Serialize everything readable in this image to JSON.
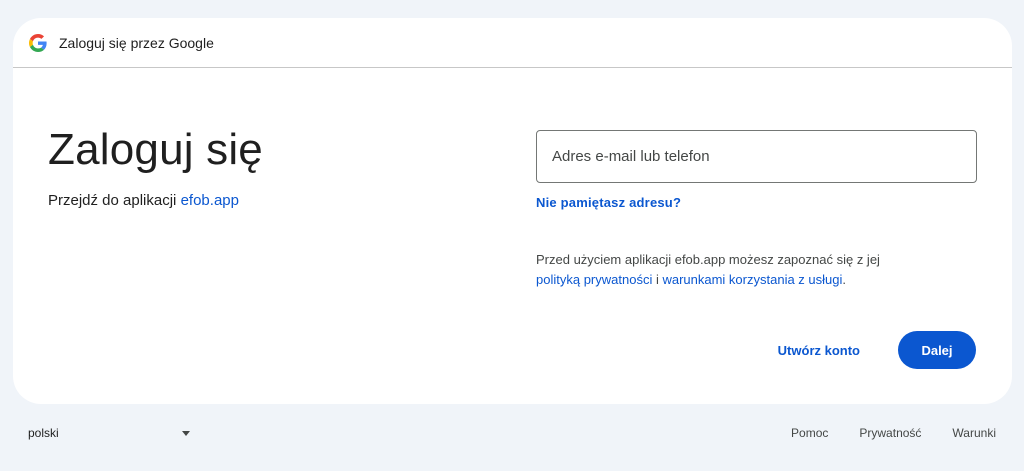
{
  "header": {
    "logo_icon": "google-g-icon",
    "title": "Zaloguj się przez Google"
  },
  "main": {
    "title": "Zaloguj się",
    "subtitle_prefix": "Przejdź do aplikacji",
    "app_name": "efob.app"
  },
  "form": {
    "email_placeholder": "Adres e-mail lub telefon",
    "email_value": "",
    "forgot_label": "Nie pamiętasz adresu?",
    "policy_text": "Przed użyciem aplikacji efob.app możesz zapoznać się z jej",
    "privacy_link": "polityką prywatności",
    "policy_and": "i",
    "terms_link": "warunkami korzystania z usługi",
    "policy_end": "."
  },
  "actions": {
    "create_label": "Utwórz konto",
    "next_label": "Dalej"
  },
  "footer": {
    "language": "polski",
    "links": [
      "Pomoc",
      "Prywatność",
      "Warunki"
    ]
  },
  "colors": {
    "page_bg": "#f0f4f9",
    "card_bg": "#ffffff",
    "accent": "#0b57d0",
    "text": "#1f1f1f"
  }
}
